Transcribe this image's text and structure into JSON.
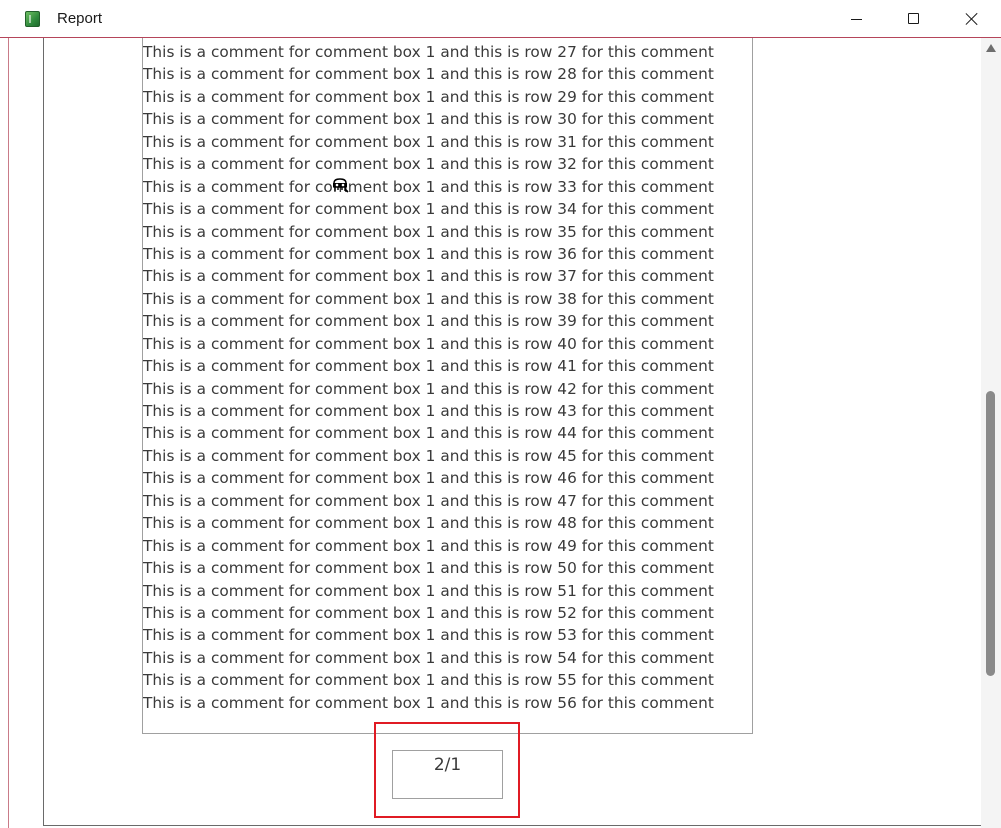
{
  "window": {
    "title": "Report",
    "icon": "access-report-icon",
    "buttons": {
      "minimize": "minimize-icon",
      "maximize": "maximize-icon",
      "close": "close-icon"
    }
  },
  "comment_box": {
    "lines": [
      "This is a comment for comment box 1 and this is row 27 for this comment",
      "This is a comment for comment box 1 and this is row 28 for this comment",
      "This is a comment for comment box 1 and this is row 29 for this comment",
      "This is a comment for comment box 1 and this is row 30 for this comment",
      "This is a comment for comment box 1 and this is row 31 for this comment",
      "This is a comment for comment box 1 and this is row 32 for this comment",
      "This is a comment for comment box 1 and this is row 33 for this comment",
      "This is a comment for comment box 1 and this is row 34 for this comment",
      "This is a comment for comment box 1 and this is row 35 for this comment",
      "This is a comment for comment box 1 and this is row 36 for this comment",
      "This is a comment for comment box 1 and this is row 37 for this comment",
      "This is a comment for comment box 1 and this is row 38 for this comment",
      "This is a comment for comment box 1 and this is row 39 for this comment",
      "This is a comment for comment box 1 and this is row 40 for this comment",
      "This is a comment for comment box 1 and this is row 41 for this comment",
      "This is a comment for comment box 1 and this is row 42 for this comment",
      "This is a comment for comment box 1 and this is row 43 for this comment",
      "This is a comment for comment box 1 and this is row 44 for this comment",
      "This is a comment for comment box 1 and this is row 45 for this comment",
      "This is a comment for comment box 1 and this is row 46 for this comment",
      "This is a comment for comment box 1 and this is row 47 for this comment",
      "This is a comment for comment box 1 and this is row 48 for this comment",
      "This is a comment for comment box 1 and this is row 49 for this comment",
      "This is a comment for comment box 1 and this is row 50 for this comment",
      "This is a comment for comment box 1 and this is row 51 for this comment",
      "This is a comment for comment box 1 and this is row 52 for this comment",
      "This is a comment for comment box 1 and this is row 53 for this comment",
      "This is a comment for comment box 1 and this is row 54 for this comment",
      "This is a comment for comment box 1 and this is row 55 for this comment",
      "This is a comment for comment box 1 and this is row 56 for this comment"
    ]
  },
  "page_number": {
    "text": "2/1",
    "highlight_color": "#e01b24"
  },
  "cursor": {
    "icon": "busy-cursor-icon"
  },
  "scrollbar": {
    "up_icon": "scroll-up-arrow-icon"
  },
  "colors": {
    "title_border": "#b5455a",
    "text": "#3a3a3a",
    "box_border": "#a0a0a0"
  }
}
